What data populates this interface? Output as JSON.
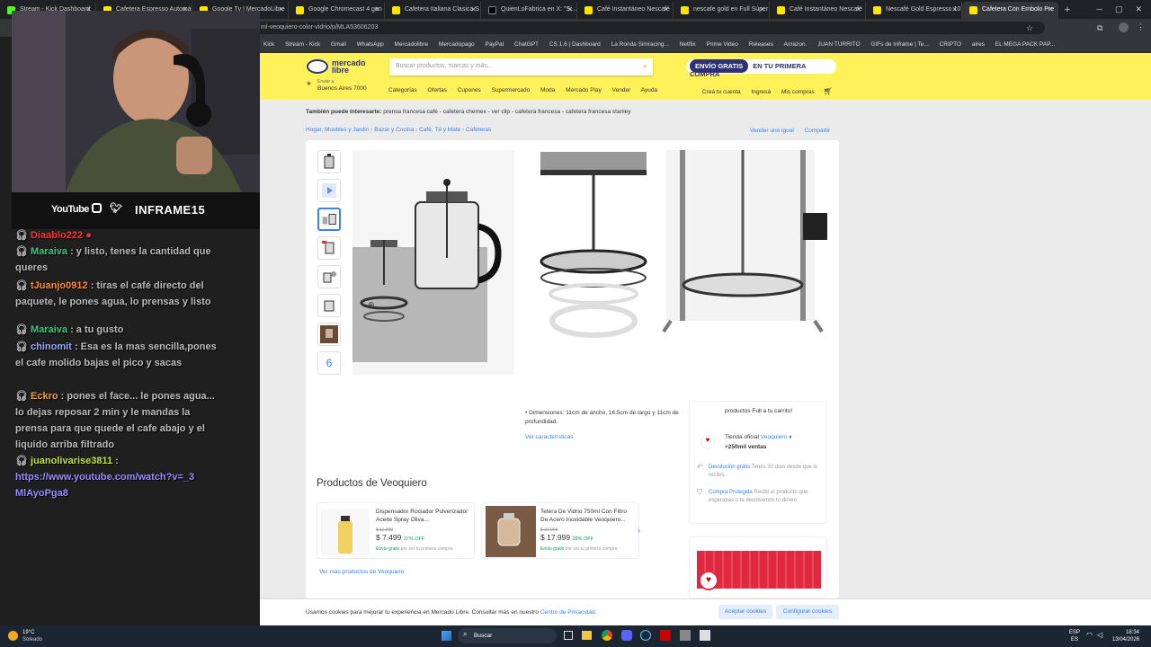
{
  "browser": {
    "tabs": [
      "Stream - Kick Dashboard",
      "Cafetera Espresso Automá",
      "Google Tv | MercadoLibre",
      "Google Chromecast 4 gen",
      "Cafetera Italiana Clasica S",
      "QuienLoFabrica en X: \"Si...",
      "Café Instantáneo Nescafé",
      "nescafe gold en Full Súper",
      "Café Instantáneo Nescafé",
      "Nescafé Gold Espresso 10",
      "Cafetera Con Embolo Pre"
    ],
    "url": "ml-veoquiero-color-vidrio/p/MLA53606203",
    "bookmarks": [
      "Kick",
      "Stream - Kick",
      "Gmail",
      "WhatsApp",
      "Mercadolibre",
      "Mercadopago",
      "PayPal",
      "ChatGPT",
      "CS 1.6 | Dashboard",
      "La Ronda Simracing...",
      "Netflix",
      "Prime Video",
      "Releases",
      "Amazon.",
      "JUAN TURRITO",
      "GIFs de Inframe | Te...",
      "CRIPTO",
      "aires",
      "EL MEGA PACK PAP..."
    ]
  },
  "stream": {
    "social_label": "YouTube",
    "channel": "INFRAME15",
    "chat": [
      {
        "user": "Diaablo222",
        "text": "",
        "color": "#ff3333"
      },
      {
        "user": "Maraiva",
        "text": ": y listo, tenes la cantidad que queres",
        "color": "#39c97a"
      },
      {
        "user": "tJuanjo0912",
        "text": ": tiras el café directo del paquete, le pones agua, lo prensas y listo",
        "color": "#ff8c2a"
      },
      {
        "user": "Maraiva",
        "text": ": a tu gusto",
        "color": "#39c97a"
      },
      {
        "user": "chinomit",
        "text": ": Esa es la mas sencilla,pones el cafe molido bajas el pico y sacas",
        "color": "#9aa7ff"
      },
      {
        "user": "Eckro",
        "text": ": pones el face... le pones agua... lo dejas reposar 2 min y le mandas la prensa para que quede el cafe abajo y el liquido arriba filtrado",
        "color": "#ff9a2a"
      },
      {
        "user": "juanolivarise3811",
        "text": ":",
        "color": "#c3e33b"
      },
      {
        "user": "",
        "text": "https://www.youtube.com/watch?v=_3MlAyoPga8",
        "color": "#9b8bff"
      }
    ]
  },
  "ml": {
    "search_placeholder": "Buscar productos, marcas y más...",
    "promo_bold": "ENVÍO GRATIS",
    "promo_rest": "EN TU PRIMERA COMPRA",
    "location_label": "Enviar a",
    "location": "Buenos Aires 7000",
    "nav": [
      "Categorías",
      "Ofertas",
      "Cupones",
      "Supermercado",
      "Moda",
      "Mercado Play",
      "Vender",
      "Ayuda"
    ],
    "user_nav": [
      "Creá tu cuenta",
      "Ingresá",
      "Mis compras"
    ],
    "also_label": "También puede interesarte:",
    "also_items": "prensa francesa café - cafetera chemex - ver clip - cafetera francesa - cafetera francesa stanley",
    "breadcrumb": [
      "Hogar, Muebles y Jardín",
      "Bazar y Cocina",
      "Café, Té y Mate",
      "Cafeteras"
    ],
    "sell_same": "Vender uno igual",
    "share": "Compartir",
    "thumb_more": "6",
    "dimensions": "Dimensiones: 11cm de ancho, 16.5cm de largo y 11cm de profundidad.",
    "see_features": "Ver características",
    "cart_text": "productos Full a tu carrito!",
    "store_label": "Tienda oficial",
    "store_name": "Veoquiero",
    "store_sales": "+250mil ventas",
    "return_title": "Devolución gratis",
    "return_text": "Tenés 30 días desde que lo recibís.",
    "protect_title": "Compra Protegida",
    "protect_text": "Recibí el producto que esperabas o te devolvemos tu dinero.",
    "seller_title": "Productos de Veoquiero",
    "products": [
      {
        "name": "Dispensador Rociador Pulverizador Aceite Spray Oliva...",
        "old": "$ 11.999",
        "price": "$ 7.499",
        "off": "37% OFF",
        "ship": "Envío gratis",
        "ship_rest": "por ser tu primera compra"
      },
      {
        "name": "Tetera De Vidrio 750ml Con Filtro De Acero Inoxidable Veoquiero...",
        "old": "$ 24.999",
        "price": "$ 17.999",
        "off": "28% OFF",
        "ship": "Envío gratis",
        "ship_rest": "por ser tu primera compra"
      }
    ],
    "see_more": "Ver más productos de Veoquiero",
    "cookie_text": "Usamos cookies para mejorar tu experiencia en Mercado Libre. Consultar más en nuestro",
    "cookie_link": "Centro de Privacidad.",
    "accept": "Aceptar cookies",
    "configure": "Configurar cookies"
  },
  "taskbar": {
    "weather_temp": "19°C",
    "weather_desc": "Soleado",
    "search": "Buscar",
    "lang1": "ESP",
    "lang2": "ES",
    "time": "18:34",
    "date": "13/04/2026"
  }
}
